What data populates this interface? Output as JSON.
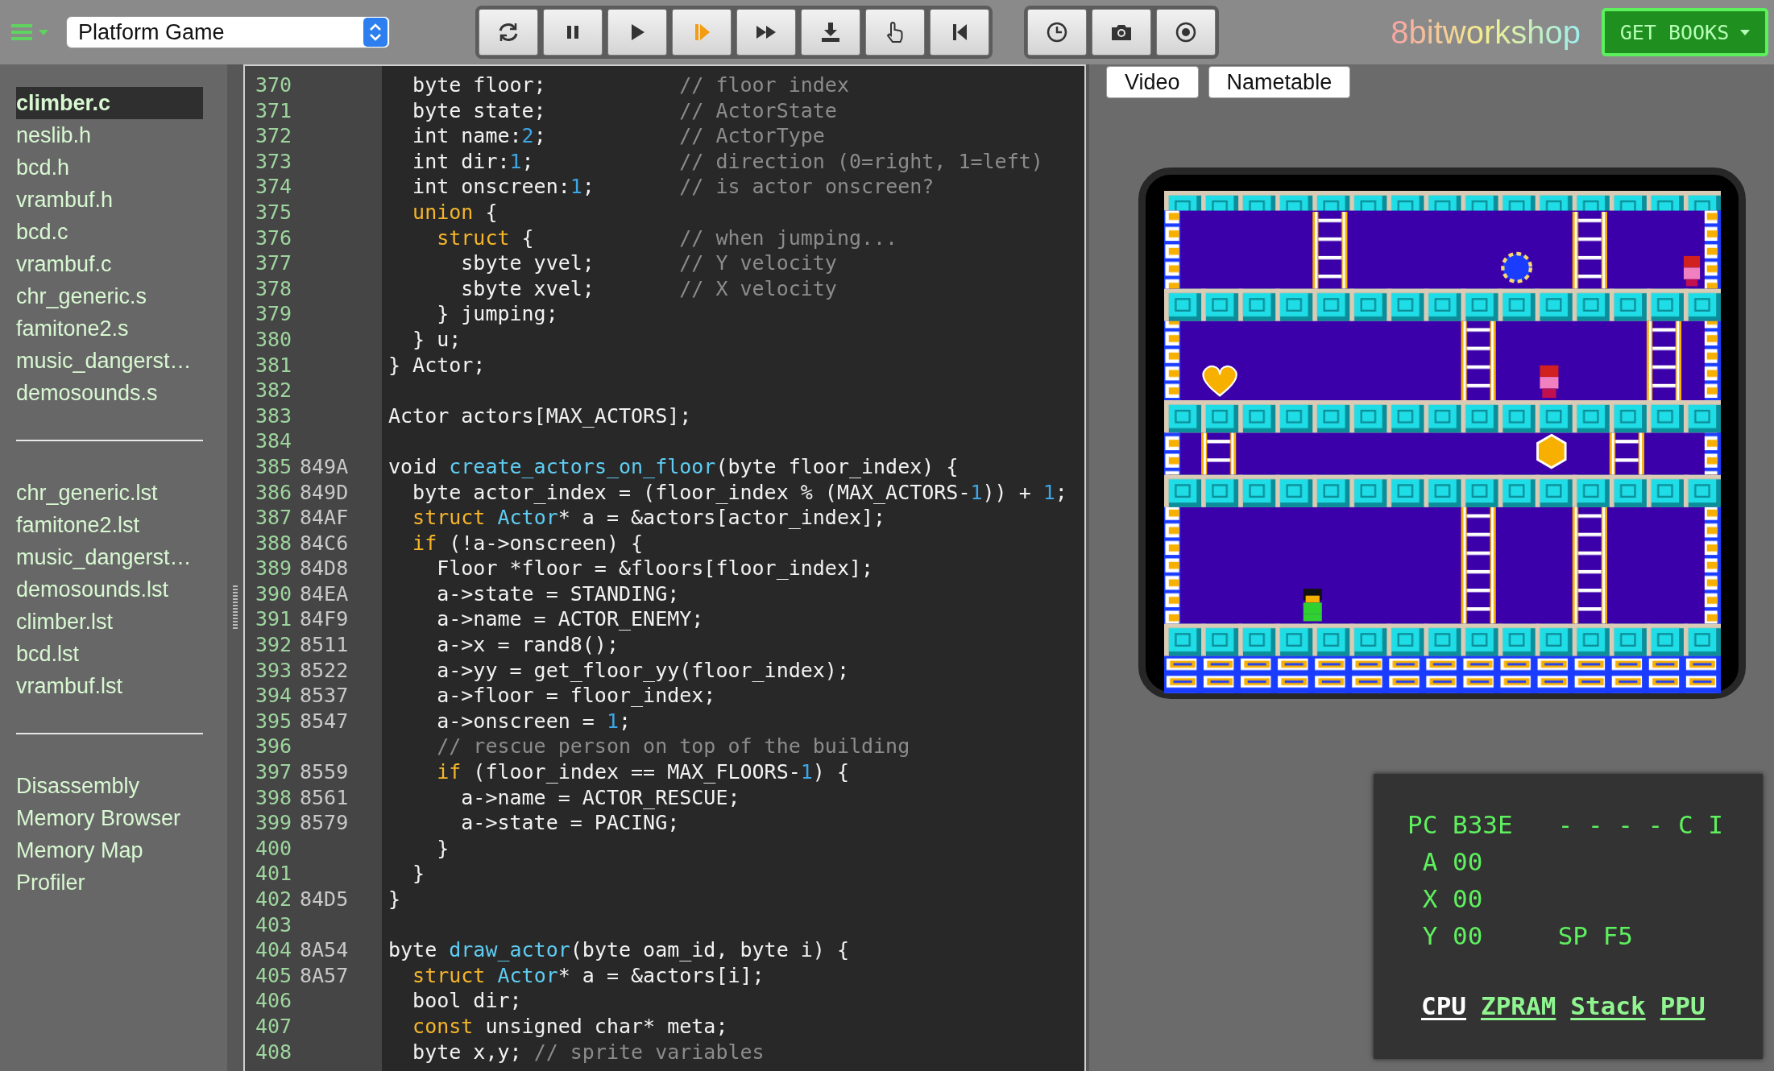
{
  "toolbar": {
    "platform": "Platform Game",
    "groups": [
      {
        "buttons": [
          {
            "kind": "reset",
            "active": false
          },
          {
            "kind": "pause",
            "active": false
          },
          {
            "kind": "play",
            "active": false
          },
          {
            "kind": "step",
            "active": true
          },
          {
            "kind": "fast-forward",
            "active": false
          },
          {
            "kind": "download",
            "active": false
          },
          {
            "kind": "pointer",
            "active": false
          },
          {
            "kind": "to-start",
            "active": false
          }
        ]
      },
      {
        "buttons": [
          {
            "kind": "clock",
            "active": false
          },
          {
            "kind": "camera",
            "active": false
          },
          {
            "kind": "record",
            "active": false
          }
        ]
      }
    ],
    "logo": "8bitworkshop",
    "books_button": "GET BOOKS"
  },
  "sidebar": {
    "sections": [
      {
        "items": [
          {
            "label": "climber.c",
            "selected": true
          },
          {
            "label": "neslib.h",
            "selected": false
          },
          {
            "label": "bcd.h",
            "selected": false
          },
          {
            "label": "vrambuf.h",
            "selected": false
          },
          {
            "label": "bcd.c",
            "selected": false
          },
          {
            "label": "vrambuf.c",
            "selected": false
          },
          {
            "label": "chr_generic.s",
            "selected": false
          },
          {
            "label": "famitone2.s",
            "selected": false
          },
          {
            "label": "music_dangerst…",
            "selected": false
          },
          {
            "label": "demosounds.s",
            "selected": false
          }
        ]
      },
      {
        "items": [
          {
            "label": "chr_generic.lst",
            "selected": false
          },
          {
            "label": "famitone2.lst",
            "selected": false
          },
          {
            "label": "music_dangerst…",
            "selected": false
          },
          {
            "label": "demosounds.lst",
            "selected": false
          },
          {
            "label": "climber.lst",
            "selected": false
          },
          {
            "label": "bcd.lst",
            "selected": false
          },
          {
            "label": "vrambuf.lst",
            "selected": false
          }
        ]
      },
      {
        "items": [
          {
            "label": "Disassembly",
            "selected": false
          },
          {
            "label": "Memory Browser",
            "selected": false
          },
          {
            "label": "Memory Map",
            "selected": false
          },
          {
            "label": "Profiler",
            "selected": false
          }
        ]
      }
    ]
  },
  "editor": {
    "lines": [
      {
        "num": "370",
        "segments": [
          {
            "kind": "plain",
            "text": "  byte floor;           "
          },
          {
            "kind": "comment",
            "text": "// floor index"
          }
        ]
      },
      {
        "num": "371",
        "segments": [
          {
            "kind": "plain",
            "text": "  byte state;           "
          },
          {
            "kind": "comment",
            "text": "// ActorState"
          }
        ]
      },
      {
        "num": "372",
        "segments": [
          {
            "kind": "plain",
            "text": "  int name:"
          },
          {
            "kind": "number",
            "text": "2"
          },
          {
            "kind": "plain",
            "text": ";           "
          },
          {
            "kind": "comment",
            "text": "// ActorType"
          }
        ]
      },
      {
        "num": "373",
        "segments": [
          {
            "kind": "plain",
            "text": "  int dir:"
          },
          {
            "kind": "number",
            "text": "1"
          },
          {
            "kind": "plain",
            "text": ";            "
          },
          {
            "kind": "comment",
            "text": "// direction (0=right, 1=left)"
          }
        ]
      },
      {
        "num": "374",
        "segments": [
          {
            "kind": "plain",
            "text": "  int onscreen:"
          },
          {
            "kind": "number",
            "text": "1"
          },
          {
            "kind": "plain",
            "text": ";       "
          },
          {
            "kind": "comment",
            "text": "// is actor onscreen?"
          }
        ]
      },
      {
        "num": "375",
        "segments": [
          {
            "kind": "keyword",
            "text": "  union"
          },
          {
            "kind": "plain",
            "text": " {"
          }
        ]
      },
      {
        "num": "376",
        "segments": [
          {
            "kind": "keyword",
            "text": "    struct"
          },
          {
            "kind": "plain",
            "text": " {            "
          },
          {
            "kind": "comment",
            "text": "// when jumping..."
          }
        ]
      },
      {
        "num": "377",
        "segments": [
          {
            "kind": "plain",
            "text": "      sbyte yvel;       "
          },
          {
            "kind": "comment",
            "text": "// Y velocity"
          }
        ]
      },
      {
        "num": "378",
        "segments": [
          {
            "kind": "plain",
            "text": "      sbyte xvel;       "
          },
          {
            "kind": "comment",
            "text": "// X velocity"
          }
        ]
      },
      {
        "num": "379",
        "segments": [
          {
            "kind": "plain",
            "text": "    } jumping;"
          }
        ]
      },
      {
        "num": "380",
        "segments": [
          {
            "kind": "plain",
            "text": "  } u;"
          }
        ]
      },
      {
        "num": "381",
        "segments": [
          {
            "kind": "plain",
            "text": "} Actor;"
          }
        ]
      },
      {
        "num": "382"
      },
      {
        "num": "383",
        "segments": [
          {
            "kind": "plain",
            "text": "Actor actors[MAX_ACTORS];"
          }
        ]
      },
      {
        "num": "384"
      },
      {
        "num": "385",
        "addr": "849A",
        "segments": [
          {
            "kind": "plain",
            "text": "void "
          },
          {
            "kind": "function",
            "text": "create_actors_on_floor"
          },
          {
            "kind": "plain",
            "text": "(byte floor_index) {"
          }
        ]
      },
      {
        "num": "386",
        "addr": "849D",
        "segments": [
          {
            "kind": "plain",
            "text": "  byte actor_index = (floor_index % (MAX_ACTORS-"
          },
          {
            "kind": "number",
            "text": "1"
          },
          {
            "kind": "plain",
            "text": ")) + "
          },
          {
            "kind": "number",
            "text": "1"
          },
          {
            "kind": "plain",
            "text": ";"
          }
        ]
      },
      {
        "num": "387",
        "addr": "84AF",
        "segments": [
          {
            "kind": "keyword",
            "text": "  struct"
          },
          {
            "kind": "type",
            "text": " Actor"
          },
          {
            "kind": "plain",
            "text": "* a = &actors[actor_index];"
          }
        ]
      },
      {
        "num": "388",
        "addr": "84C6",
        "segments": [
          {
            "kind": "keyword",
            "text": "  if"
          },
          {
            "kind": "plain",
            "text": " (!a->onscreen) {"
          }
        ]
      },
      {
        "num": "389",
        "addr": "84D8",
        "segments": [
          {
            "kind": "plain",
            "text": "    Floor *floor = &floors[floor_index];"
          }
        ]
      },
      {
        "num": "390",
        "addr": "84EA",
        "segments": [
          {
            "kind": "plain",
            "text": "    a->state = STANDING;"
          }
        ]
      },
      {
        "num": "391",
        "addr": "84F9",
        "segments": [
          {
            "kind": "plain",
            "text": "    a->name = ACTOR_ENEMY;"
          }
        ]
      },
      {
        "num": "392",
        "addr": "8511",
        "segments": [
          {
            "kind": "plain",
            "text": "    a->x = rand8();"
          }
        ]
      },
      {
        "num": "393",
        "addr": "8522",
        "segments": [
          {
            "kind": "plain",
            "text": "    a->yy = get_floor_yy(floor_index);"
          }
        ]
      },
      {
        "num": "394",
        "addr": "8537",
        "segments": [
          {
            "kind": "plain",
            "text": "    a->floor = floor_index;"
          }
        ]
      },
      {
        "num": "395",
        "addr": "8547",
        "segments": [
          {
            "kind": "plain",
            "text": "    a->onscreen = "
          },
          {
            "kind": "number",
            "text": "1"
          },
          {
            "kind": "plain",
            "text": ";"
          }
        ]
      },
      {
        "num": "396",
        "segments": [
          {
            "kind": "comment",
            "text": "    // rescue person on top of the building"
          }
        ]
      },
      {
        "num": "397",
        "addr": "8559",
        "segments": [
          {
            "kind": "keyword",
            "text": "    if"
          },
          {
            "kind": "plain",
            "text": " (floor_index == MAX_FLOORS-"
          },
          {
            "kind": "number",
            "text": "1"
          },
          {
            "kind": "plain",
            "text": ") {"
          }
        ]
      },
      {
        "num": "398",
        "addr": "8561",
        "segments": [
          {
            "kind": "plain",
            "text": "      a->name = ACTOR_RESCUE;"
          }
        ]
      },
      {
        "num": "399",
        "addr": "8579",
        "segments": [
          {
            "kind": "plain",
            "text": "      a->state = PACING;"
          }
        ]
      },
      {
        "num": "400",
        "segments": [
          {
            "kind": "plain",
            "text": "    }"
          }
        ]
      },
      {
        "num": "401",
        "segments": [
          {
            "kind": "plain",
            "text": "  }"
          }
        ]
      },
      {
        "num": "402",
        "addr": "84D5",
        "segments": [
          {
            "kind": "plain",
            "text": "}"
          }
        ]
      },
      {
        "num": "403"
      },
      {
        "num": "404",
        "addr": "8A54",
        "segments": [
          {
            "kind": "plain",
            "text": "byte "
          },
          {
            "kind": "function",
            "text": "draw_actor"
          },
          {
            "kind": "plain",
            "text": "(byte oam_id, byte i) {"
          }
        ]
      },
      {
        "num": "405",
        "addr": "8A57",
        "segments": [
          {
            "kind": "keyword",
            "text": "  struct"
          },
          {
            "kind": "type",
            "text": " Actor"
          },
          {
            "kind": "plain",
            "text": "* a = &actors[i];"
          }
        ]
      },
      {
        "num": "406",
        "segments": [
          {
            "kind": "plain",
            "text": "  bool dir;"
          }
        ]
      },
      {
        "num": "407",
        "segments": [
          {
            "kind": "keyword",
            "text": "  const"
          },
          {
            "kind": "plain",
            "text": " unsigned char* meta;"
          }
        ]
      },
      {
        "num": "408",
        "segments": [
          {
            "kind": "plain",
            "text": "  byte x,y; "
          },
          {
            "kind": "comment",
            "text": "// sprite variables"
          }
        ]
      }
    ]
  },
  "view_tabs": [
    "Video",
    "Nametable"
  ],
  "debug": {
    "lines": [
      "PC B33E   - - - - C I",
      " A 00",
      " X 00",
      " Y 00     SP F5"
    ],
    "tabs": [
      {
        "label": "CPU",
        "selected": true
      },
      {
        "label": "ZPRAM",
        "selected": false
      },
      {
        "label": "Stack",
        "selected": false
      },
      {
        "label": "PPU",
        "selected": false
      }
    ]
  }
}
